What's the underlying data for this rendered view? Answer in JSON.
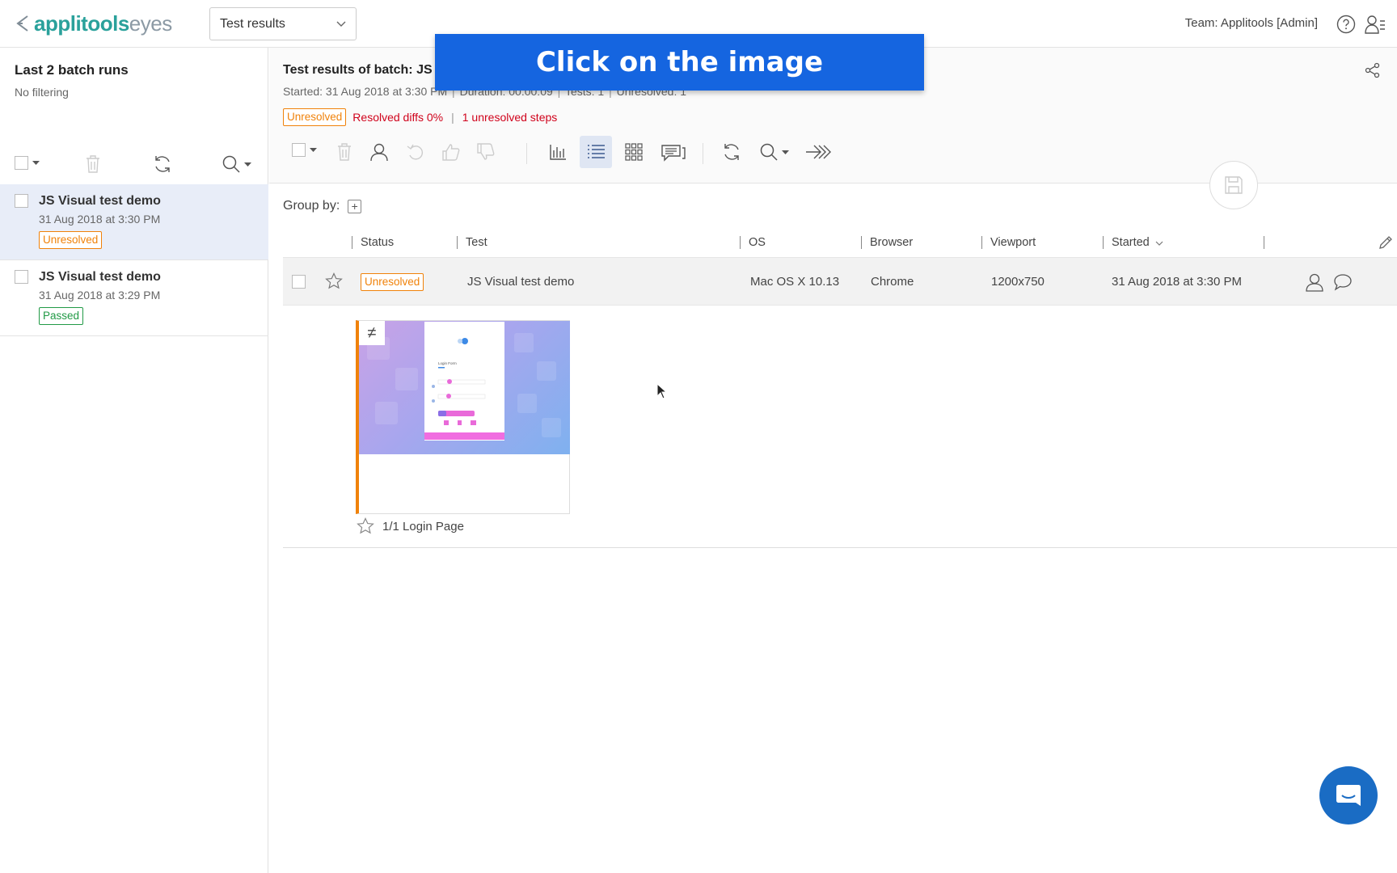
{
  "header": {
    "brand_primary": "applitools",
    "brand_secondary": "eyes",
    "view_select": "Test results",
    "team_label": "Team: Applitools  [Admin]"
  },
  "left_panel": {
    "title": "Last 2 batch runs",
    "filter": "No filtering",
    "batches": [
      {
        "name": "JS Visual test demo",
        "date": "31 Aug 2018 at 3:30 PM",
        "status": "Unresolved"
      },
      {
        "name": "JS Visual test demo",
        "date": "31 Aug 2018 at 3:29 PM",
        "status": "Passed"
      }
    ]
  },
  "main": {
    "title": "Test results of batch: JS",
    "meta": {
      "started": "Started: 31 Aug 2018 at 3:30 PM",
      "duration": "Duration: 00:00:09",
      "tests": "Tests: 1",
      "unresolved": "Unresolved: 1"
    },
    "status_badge": "Unresolved",
    "resolved_diffs": "Resolved diffs 0%",
    "unresolved_steps": "1 unresolved steps",
    "group_by_label": "Group by:"
  },
  "banner": {
    "text": "Click on the image"
  },
  "table": {
    "columns": [
      "Status",
      "Test",
      "OS",
      "Browser",
      "Viewport",
      "Started"
    ],
    "row": {
      "status": "Unresolved",
      "test": "JS Visual test demo",
      "os": "Mac OS X 10.13",
      "browser": "Chrome",
      "viewport": "1200x750",
      "started": "31 Aug 2018 at 3:30 PM"
    }
  },
  "step": {
    "diff_symbol": "≠",
    "label": "1/1 Login Page",
    "thumbnail_title": "Login Form"
  },
  "colors": {
    "brand": "#2aa19b",
    "unresolved": "#f0820a",
    "passed": "#219a46",
    "error_red": "#d0021b",
    "banner": "#1565e0",
    "selected_row": "#e8edf8",
    "chat": "#1a6cc4"
  }
}
